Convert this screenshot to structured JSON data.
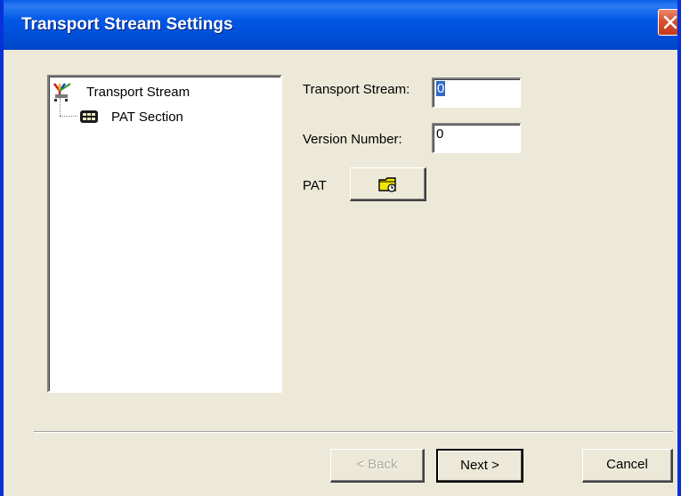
{
  "window": {
    "title": "Transport Stream Settings"
  },
  "tree": {
    "items": [
      {
        "label": "Transport Stream",
        "icon": "transport-stream-icon"
      },
      {
        "label": "PAT Section",
        "icon": "pat-section-icon"
      }
    ]
  },
  "form": {
    "transport_stream": {
      "label": "Transport Stream:",
      "value": "0"
    },
    "version_number": {
      "label": "Version Number:",
      "value": "0"
    },
    "pat": {
      "label": "PAT",
      "button_icon": "folder-edit-icon"
    }
  },
  "buttons": {
    "back": "< Back",
    "next": "Next >",
    "cancel": "Cancel"
  },
  "colors": {
    "titlebar": "#0054e3",
    "dialog_bg": "#ece9d8",
    "selection": "#316ac5",
    "close_button": "#d8502f"
  }
}
